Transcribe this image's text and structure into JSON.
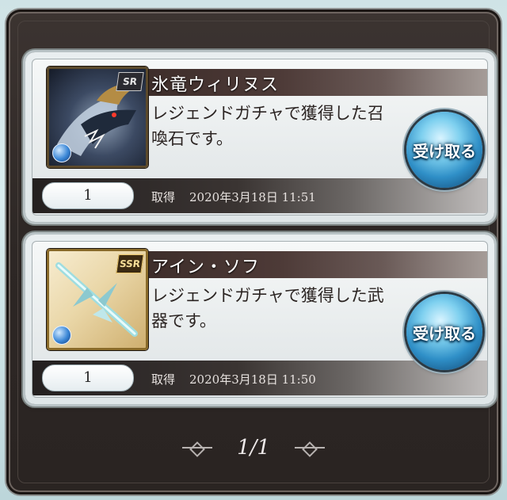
{
  "cards": [
    {
      "name": "氷竜ウィリヌス",
      "description": "レジェンドガチャで獲得した召喚石です。",
      "rarity": "SR",
      "quantity": "1",
      "acquired_label": "取得",
      "acquired_time": "2020年3月18日 11:51",
      "receive_label": "受け取る"
    },
    {
      "name": "アイン・ソフ",
      "description": "レジェンドガチャで獲得した武器です。",
      "rarity": "SSR",
      "quantity": "1",
      "acquired_label": "取得",
      "acquired_time": "2020年3月18日 11:50",
      "receive_label": "受け取る"
    }
  ],
  "pager": {
    "text": "1/1"
  },
  "colors": {
    "frame": "#2d2725",
    "title_bar": "#3d2d2a",
    "receive_button": "#2f8fc7"
  },
  "icons": {
    "element": "water-element-icon",
    "prev": "prev-page-icon",
    "next": "next-page-icon"
  }
}
